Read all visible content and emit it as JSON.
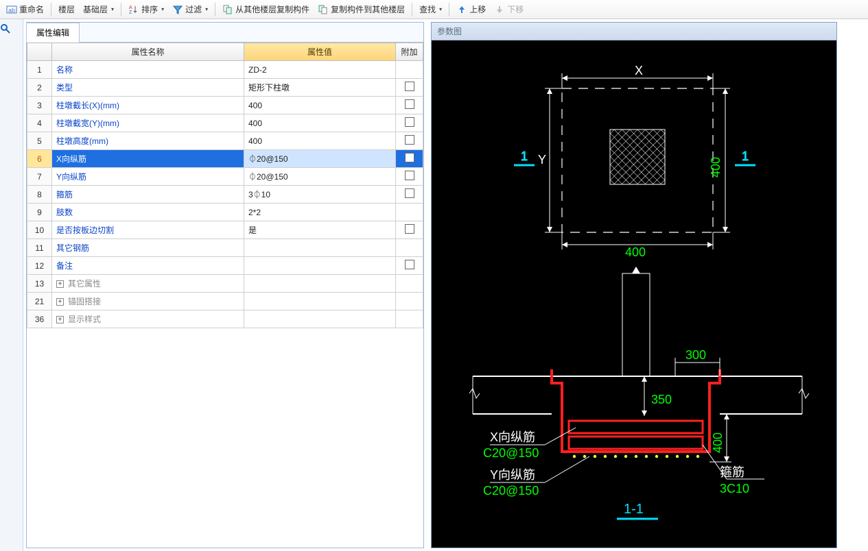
{
  "toolbar": {
    "rename": "重命名",
    "floor": "楼层",
    "base": "基础层",
    "sort": "排序",
    "filter": "过滤",
    "copy_from": "从其他楼层复制构件",
    "copy_to": "复制构件到其他楼层",
    "find": "查找",
    "up": "上移",
    "down": "下移"
  },
  "panel": {
    "tab": "属性编辑",
    "col_name": "属性名称",
    "col_value": "属性值",
    "col_extra": "附加"
  },
  "rows": [
    {
      "idx": "1",
      "name": "名称",
      "value": "ZD-2",
      "chk": null
    },
    {
      "idx": "2",
      "name": "类型",
      "value": "矩形下柱墩",
      "chk": true
    },
    {
      "idx": "3",
      "name": "柱墩截长(X)(mm)",
      "value": "400",
      "chk": true
    },
    {
      "idx": "4",
      "name": "柱墩截宽(Y)(mm)",
      "value": "400",
      "chk": true
    },
    {
      "idx": "5",
      "name": "柱墩高度(mm)",
      "value": "400",
      "chk": true
    },
    {
      "idx": "6",
      "name": "X向纵筋",
      "value": "⏀20@150",
      "chk": true,
      "selected": true
    },
    {
      "idx": "7",
      "name": "Y向纵筋",
      "value": "⏀20@150",
      "chk": true
    },
    {
      "idx": "8",
      "name": "箍筋",
      "value": "3⏀10",
      "chk": true
    },
    {
      "idx": "9",
      "name": "肢数",
      "value": "2*2",
      "chk": null
    },
    {
      "idx": "10",
      "name": "是否按板边切割",
      "value": "是",
      "chk": true
    },
    {
      "idx": "11",
      "name": "其它钢筋",
      "value": "",
      "chk": null
    },
    {
      "idx": "12",
      "name": "备注",
      "value": "",
      "chk": true
    },
    {
      "idx": "13",
      "name": "其它属性",
      "value": "",
      "group": true
    },
    {
      "idx": "21",
      "name": "锚固搭接",
      "value": "",
      "group": true
    },
    {
      "idx": "36",
      "name": "显示样式",
      "value": "",
      "group": true
    }
  ],
  "diagram": {
    "title": "参数图",
    "dim_x": "X",
    "dim_y": "Y",
    "dim_400a": "400",
    "dim_400b": "400",
    "dim_300": "300",
    "dim_350": "350",
    "dim_400c": "400",
    "sec_mark_1": "1",
    "sec_label": "1-1",
    "x_label": "X向纵筋",
    "x_val": "C20@150",
    "y_label": "Y向纵筋",
    "y_val": "C20@150",
    "stirrup_label": "箍筋",
    "stirrup_val": "3C10"
  }
}
